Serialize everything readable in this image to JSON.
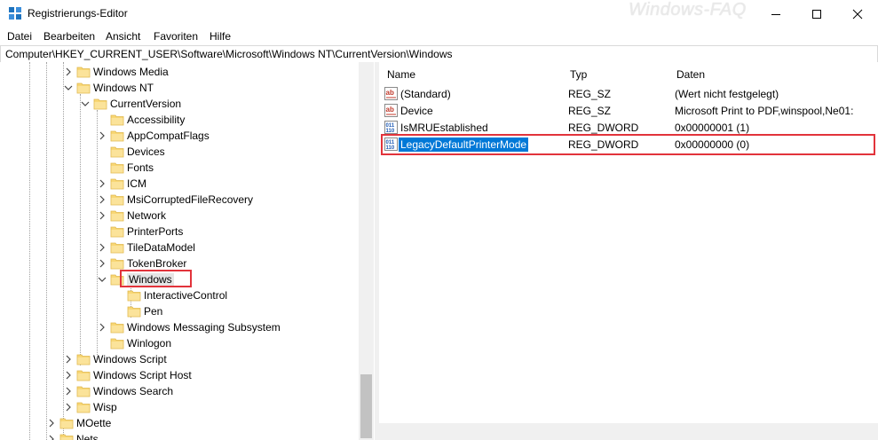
{
  "window": {
    "title": "Registrierungs-Editor",
    "watermark": "Windows-FAQ",
    "controls": [
      "minimize-icon",
      "maximize-icon",
      "close-icon"
    ]
  },
  "menu": [
    "Datei",
    "Bearbeiten",
    "Ansicht",
    "Favoriten",
    "Hilfe"
  ],
  "address": "Computer\\HKEY_CURRENT_USER\\Software\\Microsoft\\Windows NT\\CurrentVersion\\Windows",
  "tree": [
    {
      "label": "Windows Media",
      "expander": "collapsed"
    },
    {
      "label": "Windows NT",
      "expander": "expanded"
    },
    {
      "label": "CurrentVersion",
      "expander": "expanded"
    },
    {
      "label": "Accessibility",
      "expander": "none"
    },
    {
      "label": "AppCompatFlags",
      "expander": "collapsed"
    },
    {
      "label": "Devices",
      "expander": "none"
    },
    {
      "label": "Fonts",
      "expander": "none"
    },
    {
      "label": "ICM",
      "expander": "collapsed"
    },
    {
      "label": "MsiCorruptedFileRecovery",
      "expander": "collapsed"
    },
    {
      "label": "Network",
      "expander": "collapsed"
    },
    {
      "label": "PrinterPorts",
      "expander": "none"
    },
    {
      "label": "TileDataModel",
      "expander": "collapsed"
    },
    {
      "label": "TokenBroker",
      "expander": "collapsed"
    },
    {
      "label": "Windows",
      "expander": "expanded",
      "selected": true
    },
    {
      "label": "InteractiveControl",
      "expander": "none"
    },
    {
      "label": "Pen",
      "expander": "none"
    },
    {
      "label": "Windows Messaging Subsystem",
      "expander": "collapsed"
    },
    {
      "label": "Winlogon",
      "expander": "none"
    },
    {
      "label": "Windows Script",
      "expander": "collapsed"
    },
    {
      "label": "Windows Script Host",
      "expander": "collapsed"
    },
    {
      "label": "Windows Search",
      "expander": "collapsed"
    },
    {
      "label": "Wisp",
      "expander": "collapsed"
    },
    {
      "label": "MOette",
      "expander": "collapsed"
    },
    {
      "label": "Nets",
      "expander": "collapsed"
    }
  ],
  "list": {
    "columns": [
      "Name",
      "Typ",
      "Daten"
    ],
    "rows": [
      {
        "icon": "string-value-icon",
        "name": "(Standard)",
        "type": "REG_SZ",
        "data": "(Wert nicht festgelegt)"
      },
      {
        "icon": "string-value-icon",
        "name": "Device",
        "type": "REG_SZ",
        "data": "Microsoft Print to PDF,winspool,Ne01:"
      },
      {
        "icon": "dword-value-icon",
        "name": "IsMRUEstablished",
        "type": "REG_DWORD",
        "data": "0x00000001 (1)"
      },
      {
        "icon": "dword-value-icon",
        "name": "LegacyDefaultPrinterMode",
        "type": "REG_DWORD",
        "data": "0x00000000 (0)",
        "selected": true
      }
    ]
  },
  "colors": {
    "selection": "#0078d7",
    "highlight_box": "#e2333b",
    "folder": "#f8d775"
  }
}
